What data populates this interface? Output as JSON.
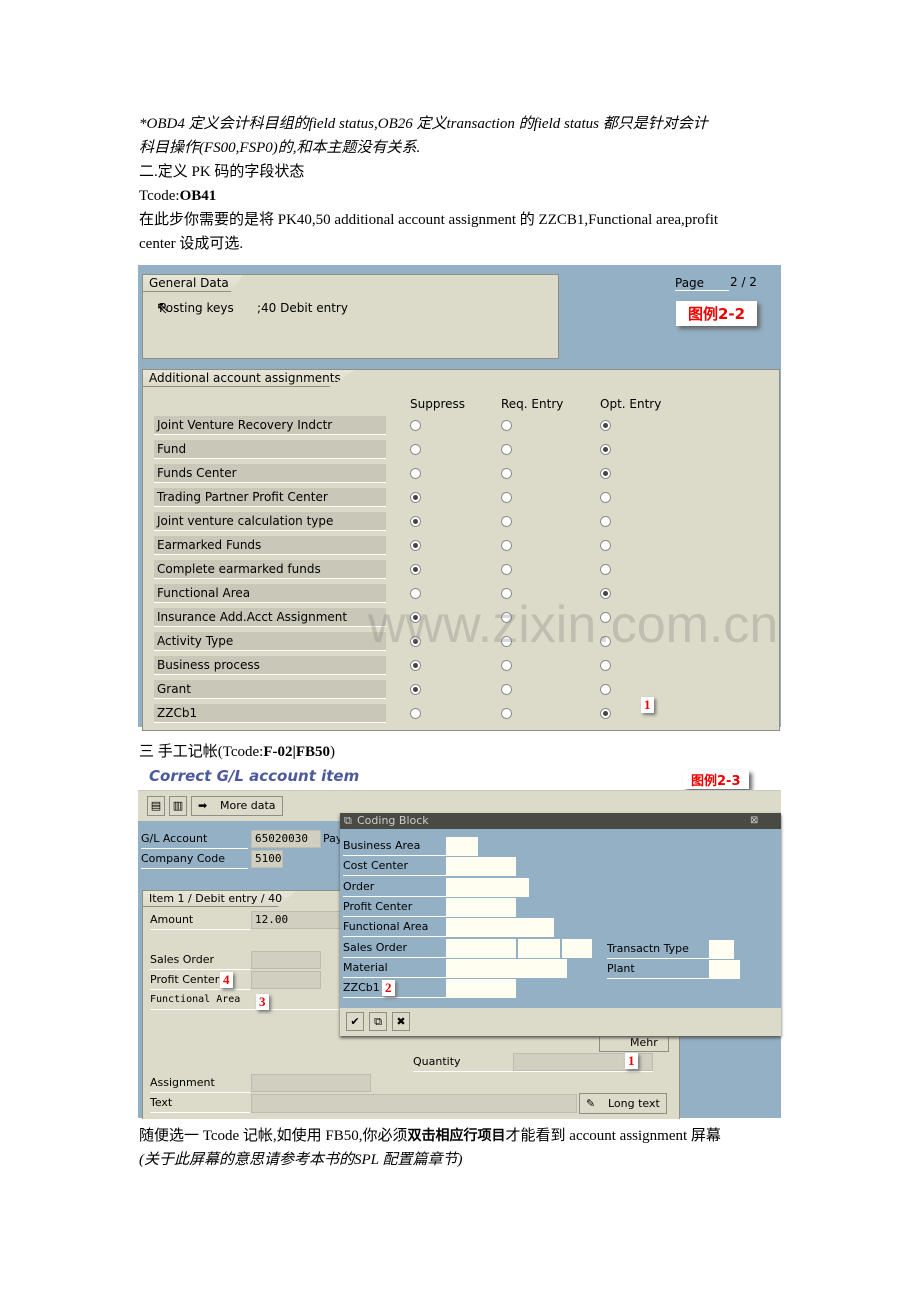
{
  "text": {
    "p1_line1": "*OBD4 定义会计科目组的field status,OB26 定义transaction 的field status 都只是针对会计",
    "p1_line2": "科目操作(FS00,FSP0)的,和本主题没有关系.",
    "h2": "二.定义 PK 码的字段状态",
    "tcode1_prefix": "Tcode:",
    "tcode1": "OB41",
    "p2_line1": "在此步你需要的是将 PK40,50 additional account assignment 的 ZZCB1,Functional area,profit",
    "p2_line2": "center 设成可选.",
    "h3_prefix": "三  手工记帐(Tcode:",
    "h3_code": "F-02|FB50",
    "h3_suffix": ")",
    "p3_a": "随便选一 Tcode 记帐,如使用 FB50,你必须",
    "p3_bold": "双击相应行项目",
    "p3_b": "才能看到 account assignment 屏幕",
    "p4": "(关于此屏幕的意思请参考本书的SPL 配置篇章节)"
  },
  "fig1": {
    "general_tab": "General Data",
    "posting_keys_label": "Posting keys",
    "posting_keys_value": ";40  Debit entry",
    "page_label": "Page",
    "page_value": "2 / 2",
    "caption": "图例2-2",
    "additional_tab": "Additional account assignments",
    "columns": [
      "Suppress",
      "Req. Entry",
      "Opt. Entry"
    ],
    "rows": [
      {
        "label": "Joint Venture Recovery Indctr",
        "selected": "Opt. Entry"
      },
      {
        "label": "Fund",
        "selected": "Opt. Entry"
      },
      {
        "label": "Funds Center",
        "selected": "Opt. Entry"
      },
      {
        "label": "Trading Partner Profit Center",
        "selected": "Suppress"
      },
      {
        "label": "Joint venture calculation type",
        "selected": "Suppress"
      },
      {
        "label": "Earmarked Funds",
        "selected": "Suppress"
      },
      {
        "label": "Complete earmarked funds",
        "selected": "Suppress"
      },
      {
        "label": "Functional Area",
        "selected": "Opt. Entry"
      },
      {
        "label": "Insurance Add.Acct Assignment",
        "selected": "Suppress"
      },
      {
        "label": "Activity Type",
        "selected": "Suppress"
      },
      {
        "label": "Business process",
        "selected": "Suppress"
      },
      {
        "label": "Grant",
        "selected": "Suppress"
      },
      {
        "label": "ZZCb1",
        "selected": "Opt. Entry"
      }
    ],
    "marker": "1",
    "watermark": "www.zixin.com.cn"
  },
  "fig2": {
    "title": "Correct G/L account item",
    "caption": "图例2-3",
    "more_data": "More data",
    "gl_account_label": "G/L Account",
    "gl_account_value": "65020030",
    "pay_partial": "Pay",
    "company_code_label": "Company Code",
    "company_code_value": "5100",
    "item_tab": "Item 1 / Debit entry / 40",
    "amount_label": "Amount",
    "amount_value": "12.00",
    "sales_order_label": "Sales Order",
    "profit_center_label": "Profit Center",
    "functional_area_label": "Functional Area",
    "quantity_label": "Quantity",
    "assignment_label": "Assignment",
    "text_label": "Text",
    "long_text": "Long text",
    "mehr": "Mehr",
    "markers": {
      "quantity": "1",
      "zzcb1": "2",
      "functional_area": "3",
      "profit_center": "4"
    },
    "popup": {
      "title": "Coding Block",
      "fields": [
        "Business Area",
        "Cost Center",
        "Order",
        "Profit Center",
        "Functional Area",
        "Sales Order",
        "Material",
        "ZZCb1"
      ],
      "right_fields": [
        "Transactn Type",
        "Plant"
      ]
    }
  }
}
